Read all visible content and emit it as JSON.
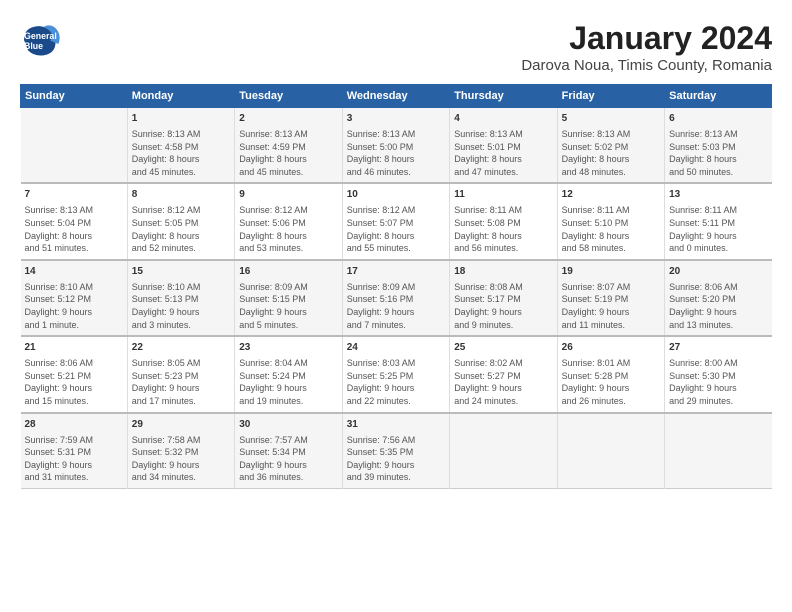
{
  "logo": {
    "line1": "General",
    "line2": "Blue"
  },
  "title": "January 2024",
  "subtitle": "Darova Noua, Timis County, Romania",
  "headers": [
    "Sunday",
    "Monday",
    "Tuesday",
    "Wednesday",
    "Thursday",
    "Friday",
    "Saturday"
  ],
  "weeks": [
    [
      {
        "day": "",
        "info": ""
      },
      {
        "day": "1",
        "info": "Sunrise: 8:13 AM\nSunset: 4:58 PM\nDaylight: 8 hours\nand 45 minutes."
      },
      {
        "day": "2",
        "info": "Sunrise: 8:13 AM\nSunset: 4:59 PM\nDaylight: 8 hours\nand 45 minutes."
      },
      {
        "day": "3",
        "info": "Sunrise: 8:13 AM\nSunset: 5:00 PM\nDaylight: 8 hours\nand 46 minutes."
      },
      {
        "day": "4",
        "info": "Sunrise: 8:13 AM\nSunset: 5:01 PM\nDaylight: 8 hours\nand 47 minutes."
      },
      {
        "day": "5",
        "info": "Sunrise: 8:13 AM\nSunset: 5:02 PM\nDaylight: 8 hours\nand 48 minutes."
      },
      {
        "day": "6",
        "info": "Sunrise: 8:13 AM\nSunset: 5:03 PM\nDaylight: 8 hours\nand 50 minutes."
      }
    ],
    [
      {
        "day": "7",
        "info": "Sunrise: 8:13 AM\nSunset: 5:04 PM\nDaylight: 8 hours\nand 51 minutes."
      },
      {
        "day": "8",
        "info": "Sunrise: 8:12 AM\nSunset: 5:05 PM\nDaylight: 8 hours\nand 52 minutes."
      },
      {
        "day": "9",
        "info": "Sunrise: 8:12 AM\nSunset: 5:06 PM\nDaylight: 8 hours\nand 53 minutes."
      },
      {
        "day": "10",
        "info": "Sunrise: 8:12 AM\nSunset: 5:07 PM\nDaylight: 8 hours\nand 55 minutes."
      },
      {
        "day": "11",
        "info": "Sunrise: 8:11 AM\nSunset: 5:08 PM\nDaylight: 8 hours\nand 56 minutes."
      },
      {
        "day": "12",
        "info": "Sunrise: 8:11 AM\nSunset: 5:10 PM\nDaylight: 8 hours\nand 58 minutes."
      },
      {
        "day": "13",
        "info": "Sunrise: 8:11 AM\nSunset: 5:11 PM\nDaylight: 9 hours\nand 0 minutes."
      }
    ],
    [
      {
        "day": "14",
        "info": "Sunrise: 8:10 AM\nSunset: 5:12 PM\nDaylight: 9 hours\nand 1 minute."
      },
      {
        "day": "15",
        "info": "Sunrise: 8:10 AM\nSunset: 5:13 PM\nDaylight: 9 hours\nand 3 minutes."
      },
      {
        "day": "16",
        "info": "Sunrise: 8:09 AM\nSunset: 5:15 PM\nDaylight: 9 hours\nand 5 minutes."
      },
      {
        "day": "17",
        "info": "Sunrise: 8:09 AM\nSunset: 5:16 PM\nDaylight: 9 hours\nand 7 minutes."
      },
      {
        "day": "18",
        "info": "Sunrise: 8:08 AM\nSunset: 5:17 PM\nDaylight: 9 hours\nand 9 minutes."
      },
      {
        "day": "19",
        "info": "Sunrise: 8:07 AM\nSunset: 5:19 PM\nDaylight: 9 hours\nand 11 minutes."
      },
      {
        "day": "20",
        "info": "Sunrise: 8:06 AM\nSunset: 5:20 PM\nDaylight: 9 hours\nand 13 minutes."
      }
    ],
    [
      {
        "day": "21",
        "info": "Sunrise: 8:06 AM\nSunset: 5:21 PM\nDaylight: 9 hours\nand 15 minutes."
      },
      {
        "day": "22",
        "info": "Sunrise: 8:05 AM\nSunset: 5:23 PM\nDaylight: 9 hours\nand 17 minutes."
      },
      {
        "day": "23",
        "info": "Sunrise: 8:04 AM\nSunset: 5:24 PM\nDaylight: 9 hours\nand 19 minutes."
      },
      {
        "day": "24",
        "info": "Sunrise: 8:03 AM\nSunset: 5:25 PM\nDaylight: 9 hours\nand 22 minutes."
      },
      {
        "day": "25",
        "info": "Sunrise: 8:02 AM\nSunset: 5:27 PM\nDaylight: 9 hours\nand 24 minutes."
      },
      {
        "day": "26",
        "info": "Sunrise: 8:01 AM\nSunset: 5:28 PM\nDaylight: 9 hours\nand 26 minutes."
      },
      {
        "day": "27",
        "info": "Sunrise: 8:00 AM\nSunset: 5:30 PM\nDaylight: 9 hours\nand 29 minutes."
      }
    ],
    [
      {
        "day": "28",
        "info": "Sunrise: 7:59 AM\nSunset: 5:31 PM\nDaylight: 9 hours\nand 31 minutes."
      },
      {
        "day": "29",
        "info": "Sunrise: 7:58 AM\nSunset: 5:32 PM\nDaylight: 9 hours\nand 34 minutes."
      },
      {
        "day": "30",
        "info": "Sunrise: 7:57 AM\nSunset: 5:34 PM\nDaylight: 9 hours\nand 36 minutes."
      },
      {
        "day": "31",
        "info": "Sunrise: 7:56 AM\nSunset: 5:35 PM\nDaylight: 9 hours\nand 39 minutes."
      },
      {
        "day": "",
        "info": ""
      },
      {
        "day": "",
        "info": ""
      },
      {
        "day": "",
        "info": ""
      }
    ]
  ]
}
